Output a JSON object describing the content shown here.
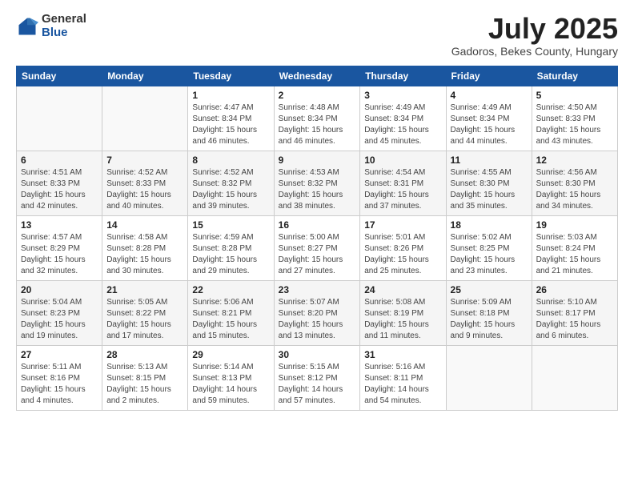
{
  "logo": {
    "general": "General",
    "blue": "Blue"
  },
  "title": {
    "month": "July 2025",
    "location": "Gadoros, Bekes County, Hungary"
  },
  "days_of_week": [
    "Sunday",
    "Monday",
    "Tuesday",
    "Wednesday",
    "Thursday",
    "Friday",
    "Saturday"
  ],
  "weeks": [
    [
      {
        "day": "",
        "info": ""
      },
      {
        "day": "",
        "info": ""
      },
      {
        "day": "1",
        "info": "Sunrise: 4:47 AM\nSunset: 8:34 PM\nDaylight: 15 hours and 46 minutes."
      },
      {
        "day": "2",
        "info": "Sunrise: 4:48 AM\nSunset: 8:34 PM\nDaylight: 15 hours and 46 minutes."
      },
      {
        "day": "3",
        "info": "Sunrise: 4:49 AM\nSunset: 8:34 PM\nDaylight: 15 hours and 45 minutes."
      },
      {
        "day": "4",
        "info": "Sunrise: 4:49 AM\nSunset: 8:34 PM\nDaylight: 15 hours and 44 minutes."
      },
      {
        "day": "5",
        "info": "Sunrise: 4:50 AM\nSunset: 8:33 PM\nDaylight: 15 hours and 43 minutes."
      }
    ],
    [
      {
        "day": "6",
        "info": "Sunrise: 4:51 AM\nSunset: 8:33 PM\nDaylight: 15 hours and 42 minutes."
      },
      {
        "day": "7",
        "info": "Sunrise: 4:52 AM\nSunset: 8:33 PM\nDaylight: 15 hours and 40 minutes."
      },
      {
        "day": "8",
        "info": "Sunrise: 4:52 AM\nSunset: 8:32 PM\nDaylight: 15 hours and 39 minutes."
      },
      {
        "day": "9",
        "info": "Sunrise: 4:53 AM\nSunset: 8:32 PM\nDaylight: 15 hours and 38 minutes."
      },
      {
        "day": "10",
        "info": "Sunrise: 4:54 AM\nSunset: 8:31 PM\nDaylight: 15 hours and 37 minutes."
      },
      {
        "day": "11",
        "info": "Sunrise: 4:55 AM\nSunset: 8:30 PM\nDaylight: 15 hours and 35 minutes."
      },
      {
        "day": "12",
        "info": "Sunrise: 4:56 AM\nSunset: 8:30 PM\nDaylight: 15 hours and 34 minutes."
      }
    ],
    [
      {
        "day": "13",
        "info": "Sunrise: 4:57 AM\nSunset: 8:29 PM\nDaylight: 15 hours and 32 minutes."
      },
      {
        "day": "14",
        "info": "Sunrise: 4:58 AM\nSunset: 8:28 PM\nDaylight: 15 hours and 30 minutes."
      },
      {
        "day": "15",
        "info": "Sunrise: 4:59 AM\nSunset: 8:28 PM\nDaylight: 15 hours and 29 minutes."
      },
      {
        "day": "16",
        "info": "Sunrise: 5:00 AM\nSunset: 8:27 PM\nDaylight: 15 hours and 27 minutes."
      },
      {
        "day": "17",
        "info": "Sunrise: 5:01 AM\nSunset: 8:26 PM\nDaylight: 15 hours and 25 minutes."
      },
      {
        "day": "18",
        "info": "Sunrise: 5:02 AM\nSunset: 8:25 PM\nDaylight: 15 hours and 23 minutes."
      },
      {
        "day": "19",
        "info": "Sunrise: 5:03 AM\nSunset: 8:24 PM\nDaylight: 15 hours and 21 minutes."
      }
    ],
    [
      {
        "day": "20",
        "info": "Sunrise: 5:04 AM\nSunset: 8:23 PM\nDaylight: 15 hours and 19 minutes."
      },
      {
        "day": "21",
        "info": "Sunrise: 5:05 AM\nSunset: 8:22 PM\nDaylight: 15 hours and 17 minutes."
      },
      {
        "day": "22",
        "info": "Sunrise: 5:06 AM\nSunset: 8:21 PM\nDaylight: 15 hours and 15 minutes."
      },
      {
        "day": "23",
        "info": "Sunrise: 5:07 AM\nSunset: 8:20 PM\nDaylight: 15 hours and 13 minutes."
      },
      {
        "day": "24",
        "info": "Sunrise: 5:08 AM\nSunset: 8:19 PM\nDaylight: 15 hours and 11 minutes."
      },
      {
        "day": "25",
        "info": "Sunrise: 5:09 AM\nSunset: 8:18 PM\nDaylight: 15 hours and 9 minutes."
      },
      {
        "day": "26",
        "info": "Sunrise: 5:10 AM\nSunset: 8:17 PM\nDaylight: 15 hours and 6 minutes."
      }
    ],
    [
      {
        "day": "27",
        "info": "Sunrise: 5:11 AM\nSunset: 8:16 PM\nDaylight: 15 hours and 4 minutes."
      },
      {
        "day": "28",
        "info": "Sunrise: 5:13 AM\nSunset: 8:15 PM\nDaylight: 15 hours and 2 minutes."
      },
      {
        "day": "29",
        "info": "Sunrise: 5:14 AM\nSunset: 8:13 PM\nDaylight: 14 hours and 59 minutes."
      },
      {
        "day": "30",
        "info": "Sunrise: 5:15 AM\nSunset: 8:12 PM\nDaylight: 14 hours and 57 minutes."
      },
      {
        "day": "31",
        "info": "Sunrise: 5:16 AM\nSunset: 8:11 PM\nDaylight: 14 hours and 54 minutes."
      },
      {
        "day": "",
        "info": ""
      },
      {
        "day": "",
        "info": ""
      }
    ]
  ]
}
